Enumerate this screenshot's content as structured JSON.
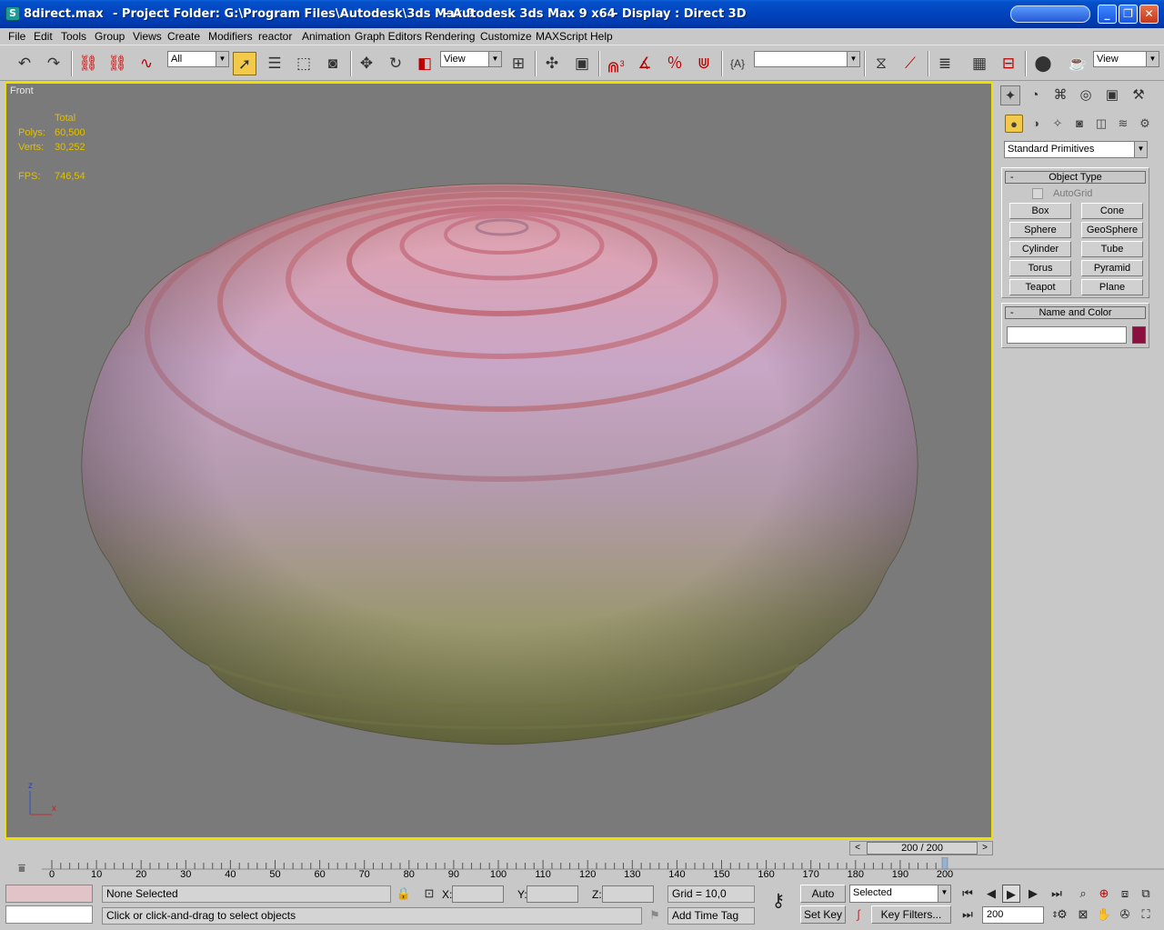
{
  "window": {
    "filename": "8direct.max",
    "project_folder": "- Project Folder: G:\\Program Files\\Autodesk\\3ds Max 9",
    "app_name": "- Autodesk 3ds Max 9 x64",
    "display": "- Display : Direct 3D"
  },
  "menu": [
    "File",
    "Edit",
    "Tools",
    "Group",
    "Views",
    "Create",
    "Modifiers",
    "reactor",
    "Animation",
    "Graph Editors",
    "Rendering",
    "Customize",
    "MAXScript",
    "Help"
  ],
  "toolbar": {
    "selection_filter": "All",
    "ref_coord": "View",
    "named_selection": "",
    "view_right": "View",
    "spinner_snap_label": "3"
  },
  "viewport": {
    "label": "Front",
    "stats_header": "Total",
    "polys_label": "Polys:",
    "polys": "60,500",
    "verts_label": "Verts:",
    "verts": "30,252",
    "fps_label": "FPS:",
    "fps": "746,54",
    "axis_z": "z",
    "axis_x": "x",
    "border_color": "#f0e000"
  },
  "command_panel": {
    "category": "Standard Primitives",
    "object_type_title": "Object Type",
    "autogrid_label": "AutoGrid",
    "primitives": [
      "Box",
      "Cone",
      "Sphere",
      "GeoSphere",
      "Cylinder",
      "Tube",
      "Torus",
      "Pyramid",
      "Teapot",
      "Plane"
    ],
    "name_color_title": "Name and Color",
    "object_name": "",
    "object_color": "#8a1040"
  },
  "timeline": {
    "frame_display": "200 / 200",
    "ticks": [
      "0",
      "10",
      "20",
      "30",
      "40",
      "50",
      "60",
      "70",
      "80",
      "90",
      "100",
      "110",
      "120",
      "130",
      "140",
      "150",
      "160",
      "170",
      "180",
      "190",
      "200"
    ],
    "current_frame_position": 1.0
  },
  "status": {
    "selection": "None Selected",
    "prompt": "Click or click-and-drag to select objects",
    "x_label": "X:",
    "y_label": "Y:",
    "z_label": "Z:",
    "x_value": "",
    "y_value": "",
    "z_value": "",
    "grid": "Grid = 10,0",
    "add_time_tag": "Add Time Tag",
    "auto_key": "Auto Key",
    "set_key": "Set Key",
    "key_mode": "Selected",
    "key_filters": "Key Filters...",
    "current_frame": "200"
  }
}
